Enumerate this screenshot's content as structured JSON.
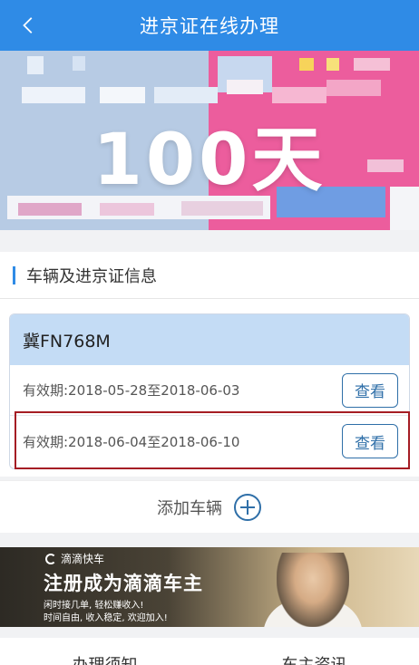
{
  "header": {
    "title": "进京证在线办理"
  },
  "banner": {
    "big_text": "100天"
  },
  "section": {
    "title": "车辆及进京证信息"
  },
  "vehicle": {
    "plate": "冀FN768M",
    "permits": [
      {
        "validity": "有效期:2018-05-28至2018-06-03",
        "button": "查看"
      },
      {
        "validity": "有效期:2018-06-04至2018-06-10",
        "button": "查看"
      }
    ]
  },
  "add_vehicle": {
    "label": "添加车辆"
  },
  "ad": {
    "brand": "滴滴快车",
    "title": "注册成为滴滴车主",
    "sub1": "闲时接几单, 轻松赚收入!",
    "sub2": "时间自由, 收入稳定, 欢迎加入!"
  },
  "bottom_tabs": [
    "办理须知",
    "车主资讯"
  ],
  "colors": {
    "header": "#2f8be6",
    "accent": "#2f6fa8",
    "highlight": "#a51d24"
  }
}
